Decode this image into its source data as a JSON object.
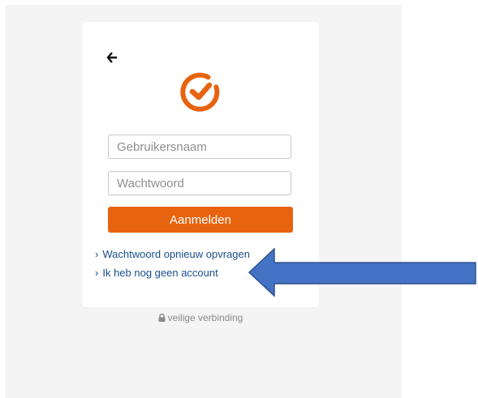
{
  "login": {
    "username_placeholder": "Gebruikersnaam",
    "password_placeholder": "Wachtwoord",
    "submit_label": "Aanmelden",
    "reset_link": "Wachtwoord opnieuw opvragen",
    "no_account_link": "Ik heb nog geen account",
    "link_chevron": "›"
  },
  "footer": {
    "secure_label": "veilige verbinding"
  },
  "icons": {
    "back": "arrow-left-icon",
    "logo": "checkmark-circle-logo",
    "lock": "lock-icon",
    "annotation": "blue-arrow-left"
  },
  "colors": {
    "brand_orange": "#e8630f",
    "link_blue": "#1a4f8b",
    "annotation_blue": "#4472c4",
    "annotation_border": "#2f528f"
  }
}
